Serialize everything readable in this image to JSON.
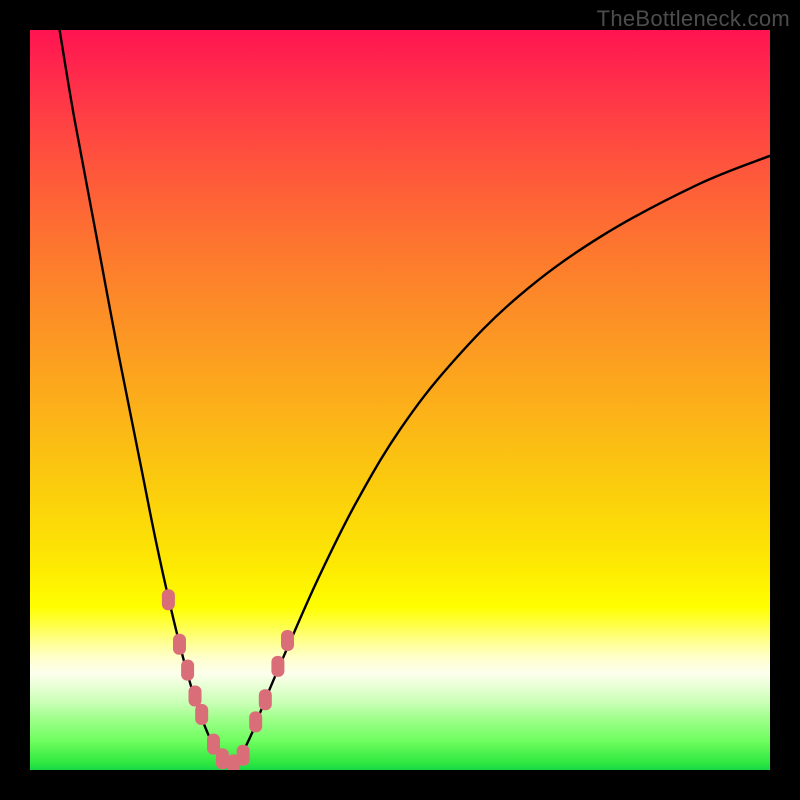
{
  "watermark": "TheBottleneck.com",
  "colors": {
    "frame": "#000000",
    "curve_stroke": "#000000",
    "marker_fill": "#d96d78",
    "marker_stroke": "#b44d58",
    "gradient_top": "#ff1450",
    "gradient_bottom": "#18d848"
  },
  "chart_data": {
    "type": "line",
    "title": "",
    "xlabel": "",
    "ylabel": "",
    "xlim": [
      0,
      100
    ],
    "ylim": [
      0,
      100
    ],
    "grid": false,
    "legend": false,
    "notes": "Two smooth curves dipping to a common minimum near zero; salmon markers cluster near the trough. Axes are unlabeled; values are estimated positions in a 0–100 normalized plot space (origin bottom-left).",
    "series": [
      {
        "name": "left-curve",
        "x": [
          4,
          6,
          9,
          12,
          15,
          17,
          19,
          21,
          22.5,
          24,
          25.5,
          27
        ],
        "y": [
          100,
          88,
          72,
          56,
          41,
          31,
          22,
          14,
          9,
          5,
          2,
          0
        ]
      },
      {
        "name": "right-curve",
        "x": [
          27,
          28.5,
          30,
          32,
          35,
          39,
          44,
          50,
          57,
          66,
          77,
          90,
          100
        ],
        "y": [
          0,
          2,
          5,
          10,
          17,
          26,
          36,
          46,
          55,
          64,
          72,
          79,
          83
        ]
      }
    ],
    "markers": {
      "name": "highlight-points",
      "shape": "rounded-rect",
      "x": [
        18.7,
        20.2,
        21.3,
        22.3,
        23.2,
        24.8,
        26.0,
        27.5,
        28.8,
        30.5,
        31.8,
        33.5,
        34.8
      ],
      "y": [
        23.0,
        17.0,
        13.5,
        10.0,
        7.5,
        3.5,
        1.5,
        0.7,
        2.0,
        6.5,
        9.5,
        14.0,
        17.5
      ]
    }
  }
}
